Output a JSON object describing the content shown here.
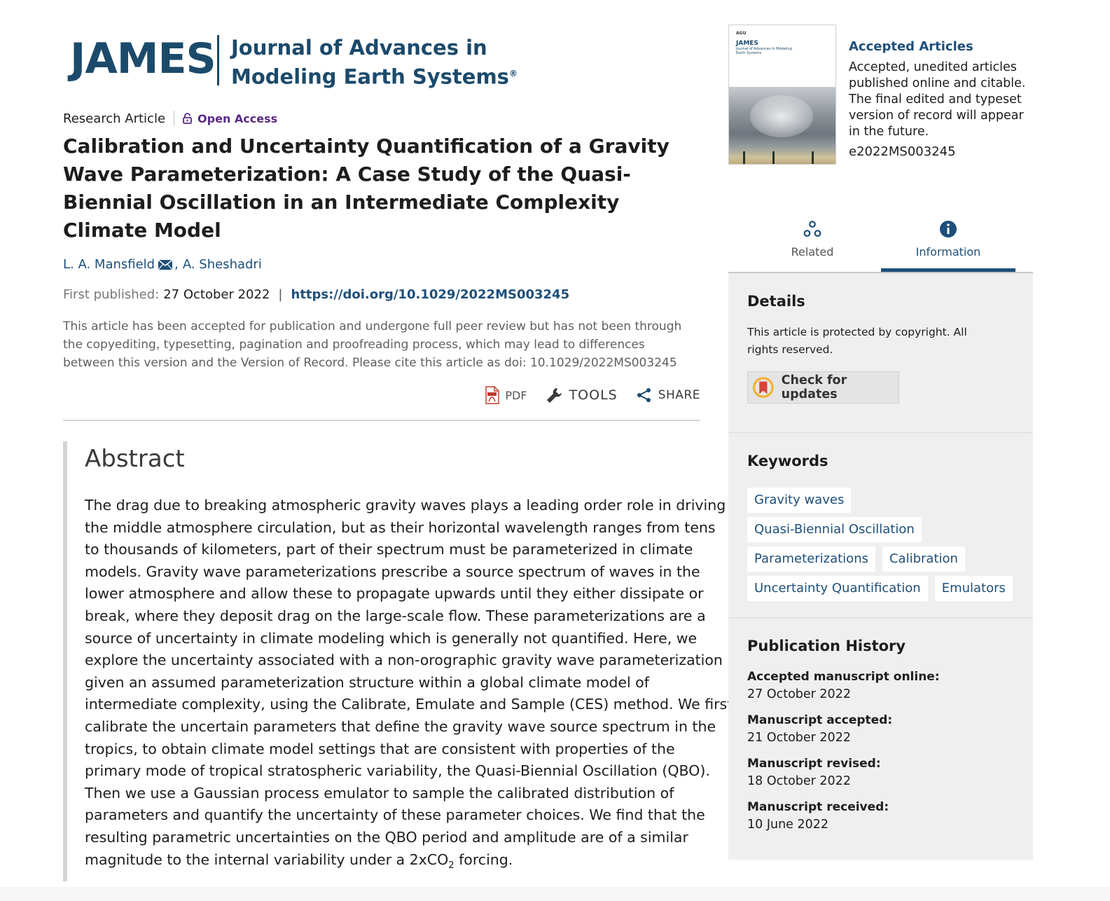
{
  "journal": {
    "logo_mark": "JAMES",
    "logo_line1": "Journal of Advances in",
    "logo_line2": "Modeling Earth Systems",
    "logo_reg": "®"
  },
  "article": {
    "type": "Research Article",
    "access": "Open Access",
    "title": "Calibration and Uncertainty Quantification of a Gravity Wave Parameterization: A Case Study of the Quasi-Biennial Oscillation in an Intermediate Complexity Climate Model",
    "authors": [
      "L. A. Mansfield",
      "A. Sheshadri"
    ],
    "author_sep": ",",
    "first_published_label": "First published:",
    "first_published_date": "27 October 2022",
    "doi_url": "https://doi.org/10.1029/2022MS003245",
    "notice": "This article has been accepted for publication and undergone full peer review but has not been through the copyediting, typesetting, pagination and proofreading process, which may lead to differences between this version and the Version of Record. Please cite this article as doi: 10.1029/2022MS003245"
  },
  "toolbar": {
    "pdf_label": "PDF",
    "tools_label": "TOOLS",
    "share_label": "SHARE"
  },
  "abstract": {
    "heading": "Abstract",
    "lines": [
      "The drag due to breaking atmospheric gravity waves plays a leading order role in driving",
      "the middle atmosphere circulation, but as their horizontal wavelength ranges from tens",
      "to thousands of kilometers, part of their spectrum must be parameterized in climate",
      "models. Gravity wave parameterizations prescribe a source spectrum of waves in the",
      "lower atmosphere and allow these to propagate upwards until they either dissipate or",
      "break, where they deposit drag on the large-scale flow. These parameterizations are a",
      "source of uncertainty in climate modeling which is generally not quantified. Here, we",
      "explore the uncertainty associated with a non-orographic gravity wave parameterization",
      "given an assumed parameterization structure within a global climate model of",
      "intermediate complexity, using the Calibrate, Emulate and Sample (CES) method. We first",
      "calibrate the uncertain parameters that define the gravity wave source spectrum in the",
      "tropics, to obtain climate model settings that are consistent with properties of the",
      "primary mode of tropical stratospheric variability, the Quasi-Biennial Oscillation (QBO).",
      "Then we use a Gaussian process emulator to sample the calibrated distribution of",
      "parameters and quantify the uncertainty of these parameter choices. We find that the",
      "resulting parametric uncertainties on the QBO period and amplitude are of a similar"
    ],
    "last_line_pre": "magnitude to the internal variability under a 2xCO",
    "last_line_sub": "2",
    "last_line_post": " forcing."
  },
  "cover": {
    "agu": "AGU",
    "james": "JAMES",
    "subtitle": "Journal of Advances in Modeling Earth Systems"
  },
  "accepted": {
    "title": "Accepted Articles",
    "description": "Accepted, unedited articles published online and citable. The final edited and typeset version of record will appear in the future.",
    "article_id": "e2022MS003245"
  },
  "tabs": [
    {
      "label": "Related",
      "icon": "related-icon",
      "active": false
    },
    {
      "label": "Information",
      "icon": "info-icon",
      "active": true
    }
  ],
  "details": {
    "heading": "Details",
    "copyright": "This article is protected by copyright. All rights reserved.",
    "check_updates_label": "Check for updates"
  },
  "keywords": {
    "heading": "Keywords",
    "items": [
      "Gravity waves",
      "Quasi-Biennial Oscillation",
      "Parameterizations",
      "Calibration",
      "Uncertainty Quantification",
      "Emulators"
    ]
  },
  "history": {
    "heading": "Publication History",
    "items": [
      {
        "label": "Accepted manuscript online:",
        "date": "27 October 2022"
      },
      {
        "label": "Manuscript accepted:",
        "date": "21 October 2022"
      },
      {
        "label": "Manuscript revised:",
        "date": "18 October 2022"
      },
      {
        "label": "Manuscript received:",
        "date": "10 June 2022"
      }
    ]
  },
  "colors": {
    "brand": "#1c4a6b",
    "link": "#1e4f7a",
    "open_access": "#5a2a82",
    "panel_bg": "#efefef"
  }
}
